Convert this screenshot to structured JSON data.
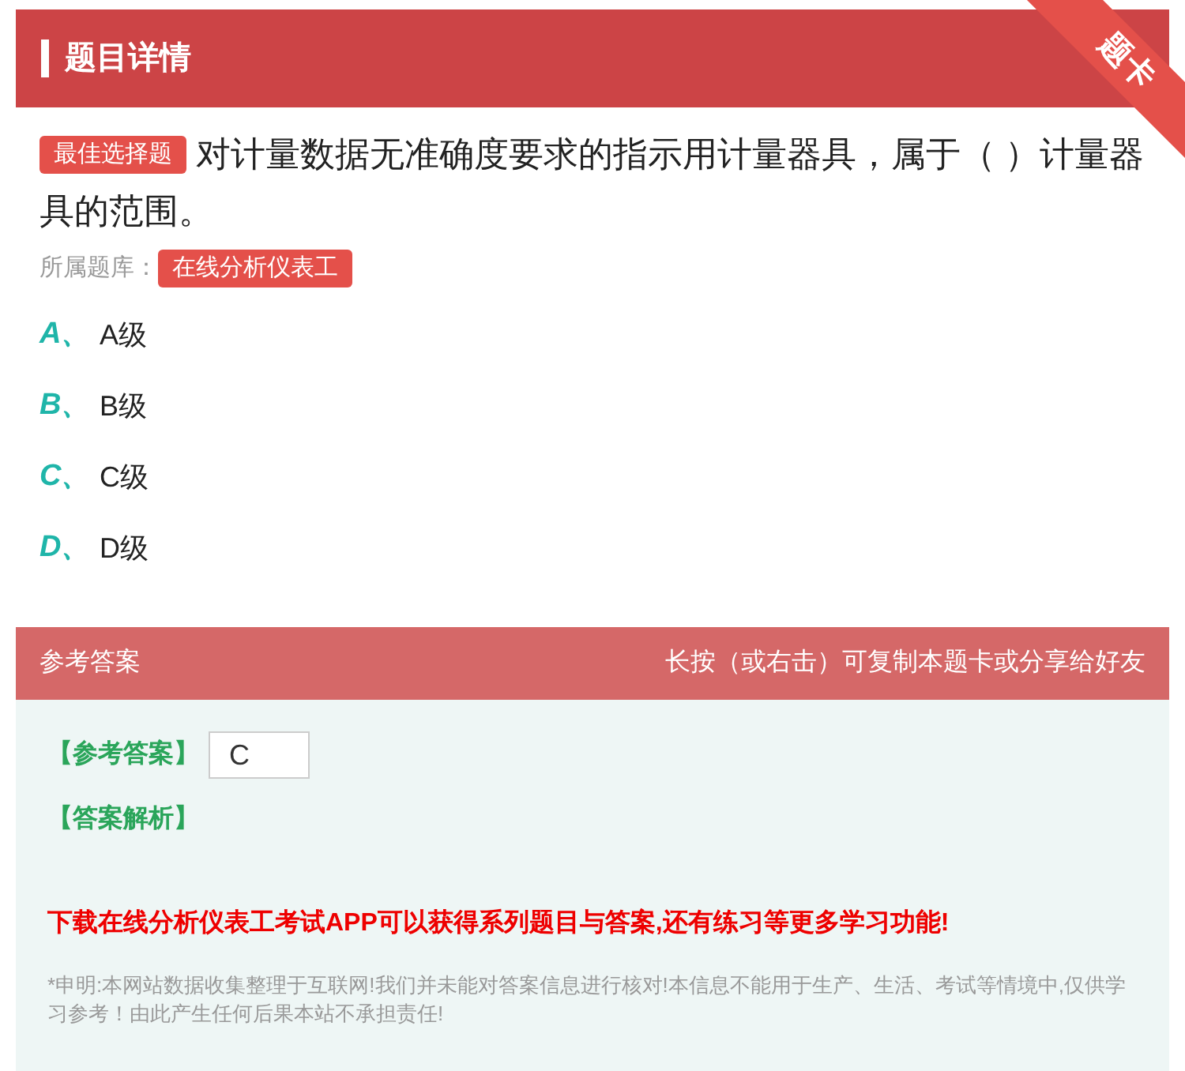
{
  "header": {
    "title": "题目详情",
    "ribbon": "题卡"
  },
  "question": {
    "type_badge": "最佳选择题",
    "text": "对计量数据无准确度要求的指示用计量器具，属于（ ）计量器具的范围。",
    "bank_label": "所属题库：",
    "bank": "在线分析仪表工"
  },
  "options": [
    {
      "letter": "A、",
      "text": "A级"
    },
    {
      "letter": "B、",
      "text": "B级"
    },
    {
      "letter": "C、",
      "text": "C级"
    },
    {
      "letter": "D、",
      "text": "D级"
    }
  ],
  "answer_bar": {
    "title": "参考答案",
    "hint": "长按（或右击）可复制本题卡或分享给好友"
  },
  "answer": {
    "label": "【参考答案】",
    "value": "C",
    "analysis_label": "【答案解析】",
    "promo": "下载在线分析仪表工考试APP可以获得系列题目与答案,还有练习等更多学习功能!",
    "disclaimer": "*申明:本网站数据收集整理于互联网!我们并未能对答案信息进行核对!本信息不能用于生产、生活、考试等情境中,仅供学习参考！由此产生任何后果本站不承担责任!"
  }
}
